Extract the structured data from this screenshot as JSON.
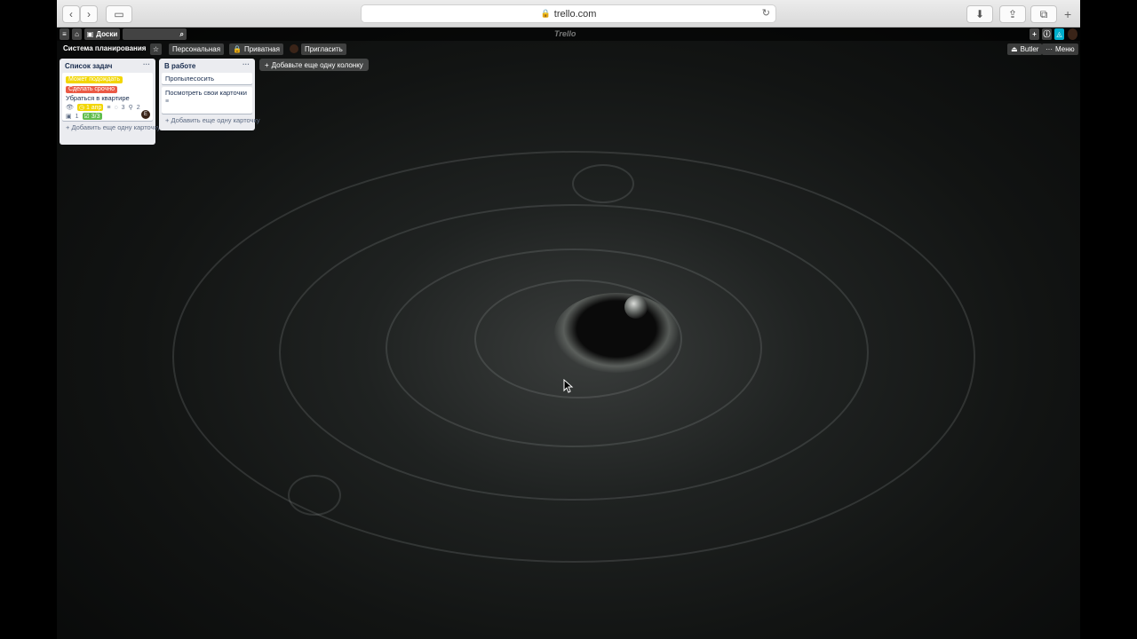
{
  "browser": {
    "url": "trello.com",
    "back_icon": "chevron-left-icon",
    "forward_icon": "chevron-right-icon"
  },
  "header": {
    "boards_label": "Доски",
    "logo": "Trello"
  },
  "board": {
    "title": "Система планирования",
    "team_label": "Персональная",
    "visibility_label": "Приватная",
    "invite_label": "Пригласить",
    "butler_label": "Butler",
    "menu_label": "Меню"
  },
  "lists": [
    {
      "title": "Список задач",
      "cards": [
        {
          "labels": [
            {
              "text": "Может подождать",
              "color": "#f2d600"
            },
            {
              "text": "Сделать срочно",
              "color": "#eb5a46"
            }
          ],
          "title": "Убраться в квартире",
          "comments": "3",
          "attachments": "2",
          "due": "1 апр",
          "card_count": "1",
          "checklist": "3/3",
          "avatar": "Е"
        }
      ],
      "add_card_label": "Добавить еще одну карточку"
    },
    {
      "title": "В работе",
      "cards": [
        {
          "title": "Пропылесосить"
        },
        {
          "title": "Посмотреть свои карточки"
        }
      ],
      "add_card_label": "Добавить еще одну карточку"
    }
  ],
  "add_list_label": "Добавьте еще одну колонку",
  "colors": {
    "trello_header": "#000000",
    "list_bg": "#ebecf0",
    "label_yellow": "#f2d600",
    "label_red": "#eb5a46",
    "label_green": "#61bd4f",
    "notification_blue": "#00aecc"
  }
}
